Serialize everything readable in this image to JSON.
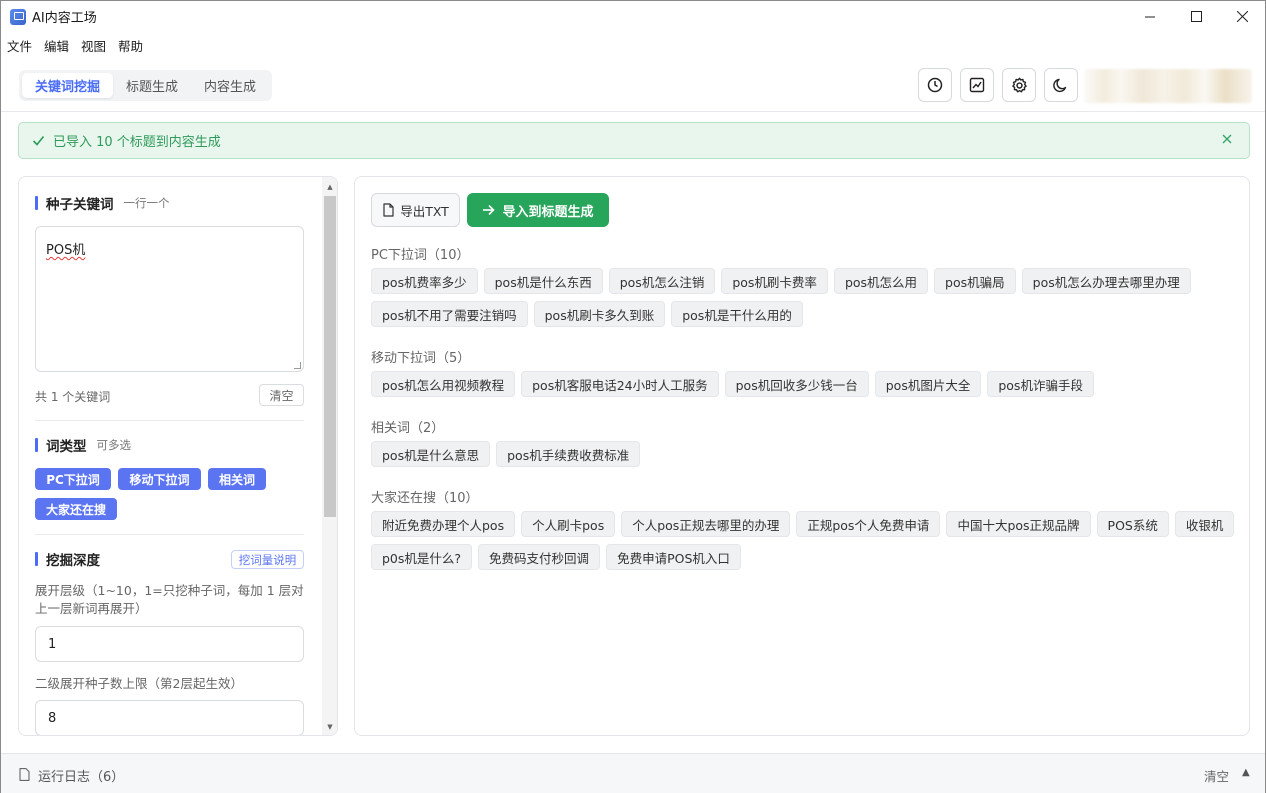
{
  "window": {
    "title": "AI内容工场",
    "minimize_icon": "minimize-icon",
    "maximize_icon": "maximize-icon",
    "close_icon": "close-icon"
  },
  "menu": [
    "文件",
    "编辑",
    "视图",
    "帮助"
  ],
  "tabs": [
    {
      "label": "关键词挖掘",
      "active": true
    },
    {
      "label": "标题生成",
      "active": false
    },
    {
      "label": "内容生成",
      "active": false
    }
  ],
  "toolbar_icons": [
    "history-clock-icon",
    "chart-icon",
    "settings-gear-icon",
    "dark-mode-moon-icon"
  ],
  "banner": {
    "text": "已导入 10 个标题到内容生成",
    "icon": "check-icon",
    "color": "#2f9a5b"
  },
  "left": {
    "seed": {
      "title": "种子关键词",
      "hint": "一行一个",
      "value": "POS机",
      "count_text": "共 1 个关键词",
      "clear_label": "清空"
    },
    "word_type": {
      "title": "词类型",
      "hint": "可多选",
      "options": [
        "PC下拉词",
        "移动下拉词",
        "相关词",
        "大家还在搜"
      ]
    },
    "depth": {
      "title": "挖掘深度",
      "help_label": "挖词量说明",
      "level_label": "展开层级（1~10，1=只挖种子词，每加 1 层对上一层新词再展开）",
      "level_value": "1",
      "limit_label": "二级展开种子数上限（第2层起生效）",
      "limit_value": "8"
    }
  },
  "right": {
    "export_label": "导出TXT",
    "import_label": "导入到标题生成",
    "accent": "#27a55a",
    "groups": [
      {
        "title": "PC下拉词（10）",
        "rows": [
          [
            "pos机费率多少",
            "pos机是什么东西",
            "pos机怎么注销",
            "pos机刷卡费率",
            "pos机怎么用",
            "pos机骗局",
            "pos机怎么办理去哪里办理"
          ],
          [
            "pos机不用了需要注销吗",
            "pos机刷卡多久到账",
            "pos机是干什么用的"
          ]
        ]
      },
      {
        "title": "移动下拉词（5）",
        "rows": [
          [
            "pos机怎么用视频教程",
            "pos机客服电话24小时人工服务",
            "pos机回收多少钱一台",
            "pos机图片大全",
            "pos机诈骗手段"
          ]
        ]
      },
      {
        "title": "相关词（2）",
        "rows": [
          [
            "pos机是什么意思",
            "pos机手续费收费标准"
          ]
        ]
      },
      {
        "title": "大家还在搜（10）",
        "rows": [
          [
            "附近免费办理个人pos",
            "个人刷卡pos",
            "个人pos正规去哪里的办理",
            "正规pos个人免费申请",
            "中国十大pos正规品牌",
            "POS系统",
            "收银机"
          ],
          [
            "p0s机是什么?",
            "免费码支付秒回调",
            "免费申请POS机入口"
          ]
        ]
      }
    ]
  },
  "footer": {
    "log_label": "运行日志（6）",
    "clear_label": "清空"
  }
}
